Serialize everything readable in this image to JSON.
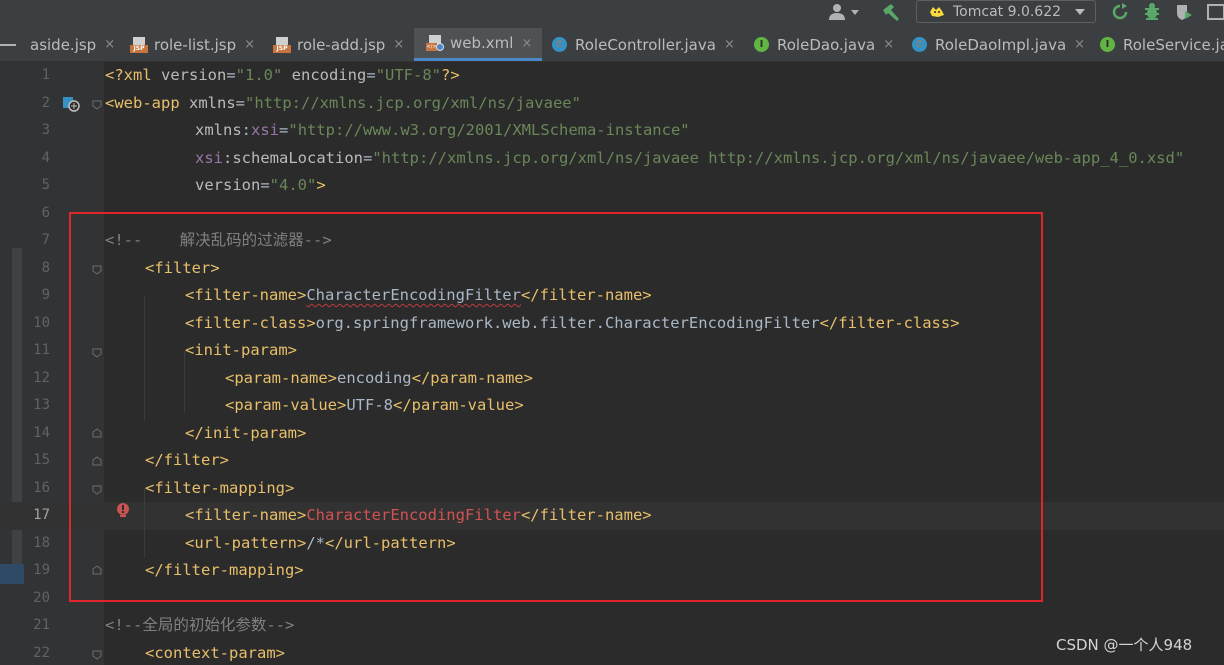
{
  "toolbar": {
    "run_config_label": "Tomcat 9.0.622",
    "icons": [
      "user-icon",
      "build-hammer-icon",
      "tomcat-icon",
      "rerun-icon",
      "debug-bug-icon",
      "coverage-shield-icon"
    ]
  },
  "tabs": [
    {
      "label": "aside.jsp",
      "icon": "jsp-file-icon"
    },
    {
      "label": "role-list.jsp",
      "icon": "jsp-file-icon"
    },
    {
      "label": "role-add.jsp",
      "icon": "jsp-file-icon"
    },
    {
      "label": "web.xml",
      "icon": "xml-web-file-icon",
      "active": true
    },
    {
      "label": "RoleController.java",
      "icon": "java-class-icon"
    },
    {
      "label": "RoleDao.java",
      "icon": "java-interface-icon"
    },
    {
      "label": "RoleDaoImpl.java",
      "icon": "java-class-icon"
    },
    {
      "label": "RoleService.ja",
      "icon": "java-interface-icon"
    }
  ],
  "close_glyph": "×",
  "editor": {
    "current_line": 17,
    "lines": [
      {
        "n": "1"
      },
      {
        "n": "2"
      },
      {
        "n": "3"
      },
      {
        "n": "4"
      },
      {
        "n": "5"
      },
      {
        "n": "6"
      },
      {
        "n": "7"
      },
      {
        "n": "8"
      },
      {
        "n": "9"
      },
      {
        "n": "10"
      },
      {
        "n": "11"
      },
      {
        "n": "12"
      },
      {
        "n": "13"
      },
      {
        "n": "14"
      },
      {
        "n": "15"
      },
      {
        "n": "16"
      },
      {
        "n": "17"
      },
      {
        "n": "18"
      },
      {
        "n": "19"
      },
      {
        "n": "20"
      },
      {
        "n": "21"
      },
      {
        "n": "22"
      }
    ],
    "code": {
      "l1_pi_open": "<?xml ",
      "l1_version_attr": "version",
      "l1_version_val": "\"1.0\"",
      "l1_encoding_attr": " encoding",
      "l1_encoding_val": "\"UTF-8\"",
      "l1_pi_close": "?>",
      "l2_tag": "<web-app ",
      "l2_attr": "xmlns",
      "l2_val": "\"http://xmlns.jcp.org/xml/ns/javaee\"",
      "l3_prefix": "xmlns",
      "l3_ns": "xsi",
      "l3_val": "\"http://www.w3.org/2001/XMLSchema-instance\"",
      "l4_ns": "xsi",
      "l4_attr": "schemaLocation",
      "l4_val": "\"http://xmlns.jcp.org/xml/ns/javaee http://xmlns.jcp.org/xml/ns/javaee/web-app_4_0.xsd\"",
      "l5_attr": "version",
      "l5_val": "\"4.0\"",
      "l5_close": ">",
      "l7_comment": "<!--    解决乱码的过滤器-->",
      "l8": "<filter>",
      "l9_open": "<filter-name>",
      "l9_text": "CharacterEncodingFilter",
      "l9_close": "</filter-name>",
      "l10_open": "<filter-class>",
      "l10_text": "org.springframework.web.filter.CharacterEncodingFilter",
      "l10_close": "</filter-class>",
      "l11": "<init-param>",
      "l12_open": "<param-name>",
      "l12_text": "encoding",
      "l12_close": "</param-name>",
      "l13_open": "<param-value>",
      "l13_text": "UTF-8",
      "l13_close": "</param-value>",
      "l14": "</init-param>",
      "l15": "</filter>",
      "l16": "<filter-mapping>",
      "l17_open": "<filter-name>",
      "l17_text": "CharacterEncodingFilter",
      "l17_close": "</filter-name>",
      "l18_open": "<url-pattern>",
      "l18_text": "/*",
      "l18_close": "</url-pattern>",
      "l19": "</filter-mapping>",
      "l21_comment": "<!--全局的初始化参数-->",
      "l22": "<context-param>"
    }
  },
  "watermark": "CSDN @一个人948",
  "colors": {
    "tag": "#e8bf6a",
    "attr": "#bababa",
    "string": "#6a8759",
    "namespace": "#9876aa",
    "comment": "#808080",
    "error": "#d25252",
    "highlight_box": "#e0262b",
    "active_tab_underline": "#4a88c7"
  }
}
